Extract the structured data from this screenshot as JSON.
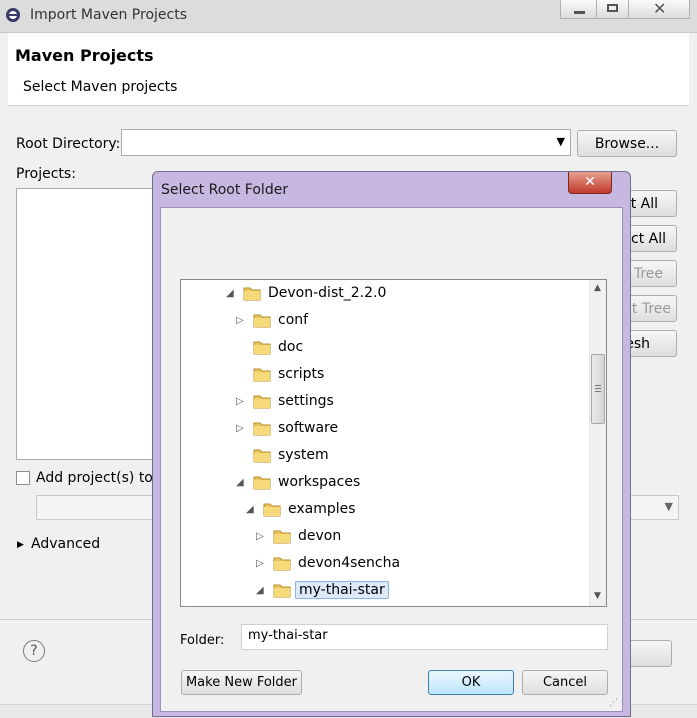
{
  "main_window": {
    "title": "Import Maven Projects",
    "header_title": "Maven Projects",
    "header_subtitle": "Select Maven projects",
    "root_dir_label": "Root Directory:",
    "root_dir_value": "",
    "browse_label": "Browse...",
    "projects_label": "Projects:",
    "side_buttons": [
      "ct All",
      "ct All",
      "Tree",
      "t Tree",
      "esh"
    ],
    "add_projects_label": "Add project(s) to",
    "advanced_label": "Advanced",
    "help_icon": "question-icon"
  },
  "dialog": {
    "title": "Select Root Folder",
    "tree": [
      {
        "label": "Devon-dist_2.2.0",
        "depth": 0,
        "arrow": "expanded"
      },
      {
        "label": "conf",
        "depth": 1,
        "arrow": "collapsed"
      },
      {
        "label": "doc",
        "depth": 1,
        "arrow": "none"
      },
      {
        "label": "scripts",
        "depth": 1,
        "arrow": "none"
      },
      {
        "label": "settings",
        "depth": 1,
        "arrow": "collapsed"
      },
      {
        "label": "software",
        "depth": 1,
        "arrow": "collapsed"
      },
      {
        "label": "system",
        "depth": 1,
        "arrow": "none"
      },
      {
        "label": "workspaces",
        "depth": 1,
        "arrow": "expanded"
      },
      {
        "label": "examples",
        "depth": 2,
        "arrow": "expanded"
      },
      {
        "label": "devon",
        "depth": 3,
        "arrow": "collapsed"
      },
      {
        "label": "devon4sencha",
        "depth": 3,
        "arrow": "collapsed"
      },
      {
        "label": "my-thai-star",
        "depth": 3,
        "arrow": "expanded",
        "selected": true
      }
    ],
    "folder_label": "Folder:",
    "folder_value": "my-thai-star",
    "make_new_folder_label": "Make New Folder",
    "ok_label": "OK",
    "cancel_label": "Cancel"
  }
}
